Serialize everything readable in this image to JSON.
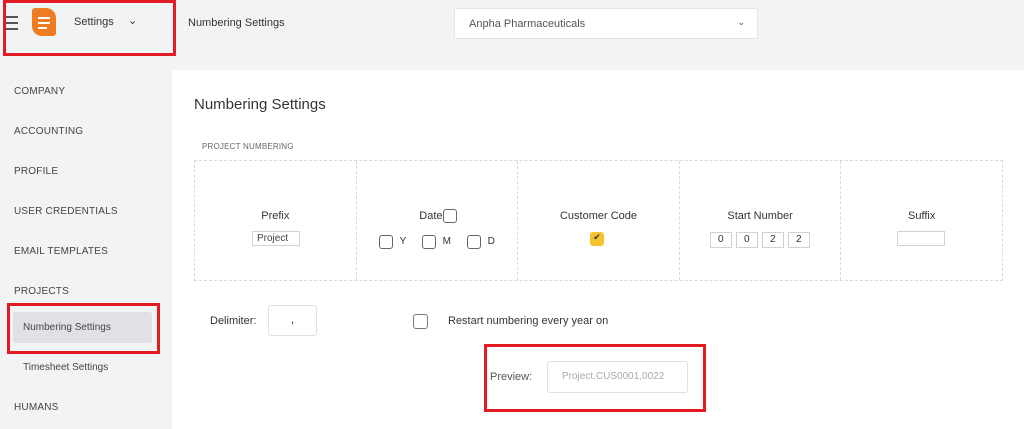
{
  "header": {
    "app_title": "Settings",
    "breadcrumb": "Numbering Settings",
    "company_select": {
      "value": "Anpha Pharmaceuticals"
    }
  },
  "sidebar": {
    "items": [
      {
        "label": "COMPANY"
      },
      {
        "label": "ACCOUNTING"
      },
      {
        "label": "PROFILE"
      },
      {
        "label": "USER CREDENTIALS"
      },
      {
        "label": "EMAIL TEMPLATES"
      },
      {
        "label": "PROJECTS"
      },
      {
        "label": "Numbering Settings",
        "active": true
      },
      {
        "label": "Timesheet Settings"
      },
      {
        "label": "HUMANS"
      }
    ]
  },
  "main": {
    "title": "Numbering Settings",
    "section_label": "PROJECT NUMBERING",
    "columns": {
      "prefix": {
        "label": "Prefix",
        "value": "Project"
      },
      "date": {
        "label": "Date",
        "checked": false,
        "options": [
          {
            "label": "Y",
            "checked": false
          },
          {
            "label": "M",
            "checked": false
          },
          {
            "label": "D",
            "checked": false
          }
        ]
      },
      "customer_code": {
        "label": "Customer Code",
        "checked": true
      },
      "start_number": {
        "label": "Start Number",
        "digits": [
          "0",
          "0",
          "2",
          "2"
        ]
      },
      "suffix": {
        "label": "Suffix",
        "value": ""
      }
    },
    "delimiter": {
      "label": "Delimiter:",
      "value": ","
    },
    "restart": {
      "label": "Restart numbering every year on",
      "checked": false
    },
    "preview": {
      "label": "Preview:",
      "value": "Project.CUS0001,0022"
    }
  },
  "colors": {
    "logo": "#ef7b22",
    "checkbox_checked": "#f4c430",
    "highlight": "#e31b23"
  }
}
